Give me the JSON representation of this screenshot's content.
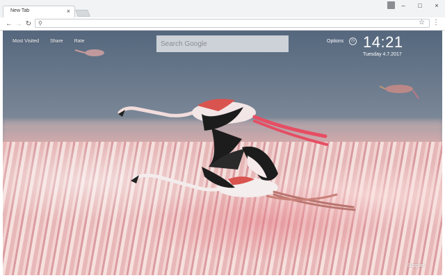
{
  "browser": {
    "tab_title": "New Tab",
    "tab_close": "×",
    "omnibox_value": "",
    "omnibox_placeholder": ""
  },
  "window_controls": {
    "minimize": "–",
    "maximize": "□",
    "close": "×"
  },
  "newtab": {
    "links": [
      "Most Visited",
      "Share",
      "Rate"
    ],
    "search_placeholder": "Search Google",
    "options_label": "Options",
    "time": "14:21",
    "date": "Tuesday  4.7.2017",
    "support_label": "Support"
  },
  "icons": [
    "back-icon",
    "forward-icon",
    "reload-icon",
    "search-icon",
    "star-icon",
    "menu-icon",
    "profile-icon",
    "clock-icon"
  ],
  "colors": {
    "clock_text": "#ffffff",
    "search_bg": "#e1e4e8"
  }
}
